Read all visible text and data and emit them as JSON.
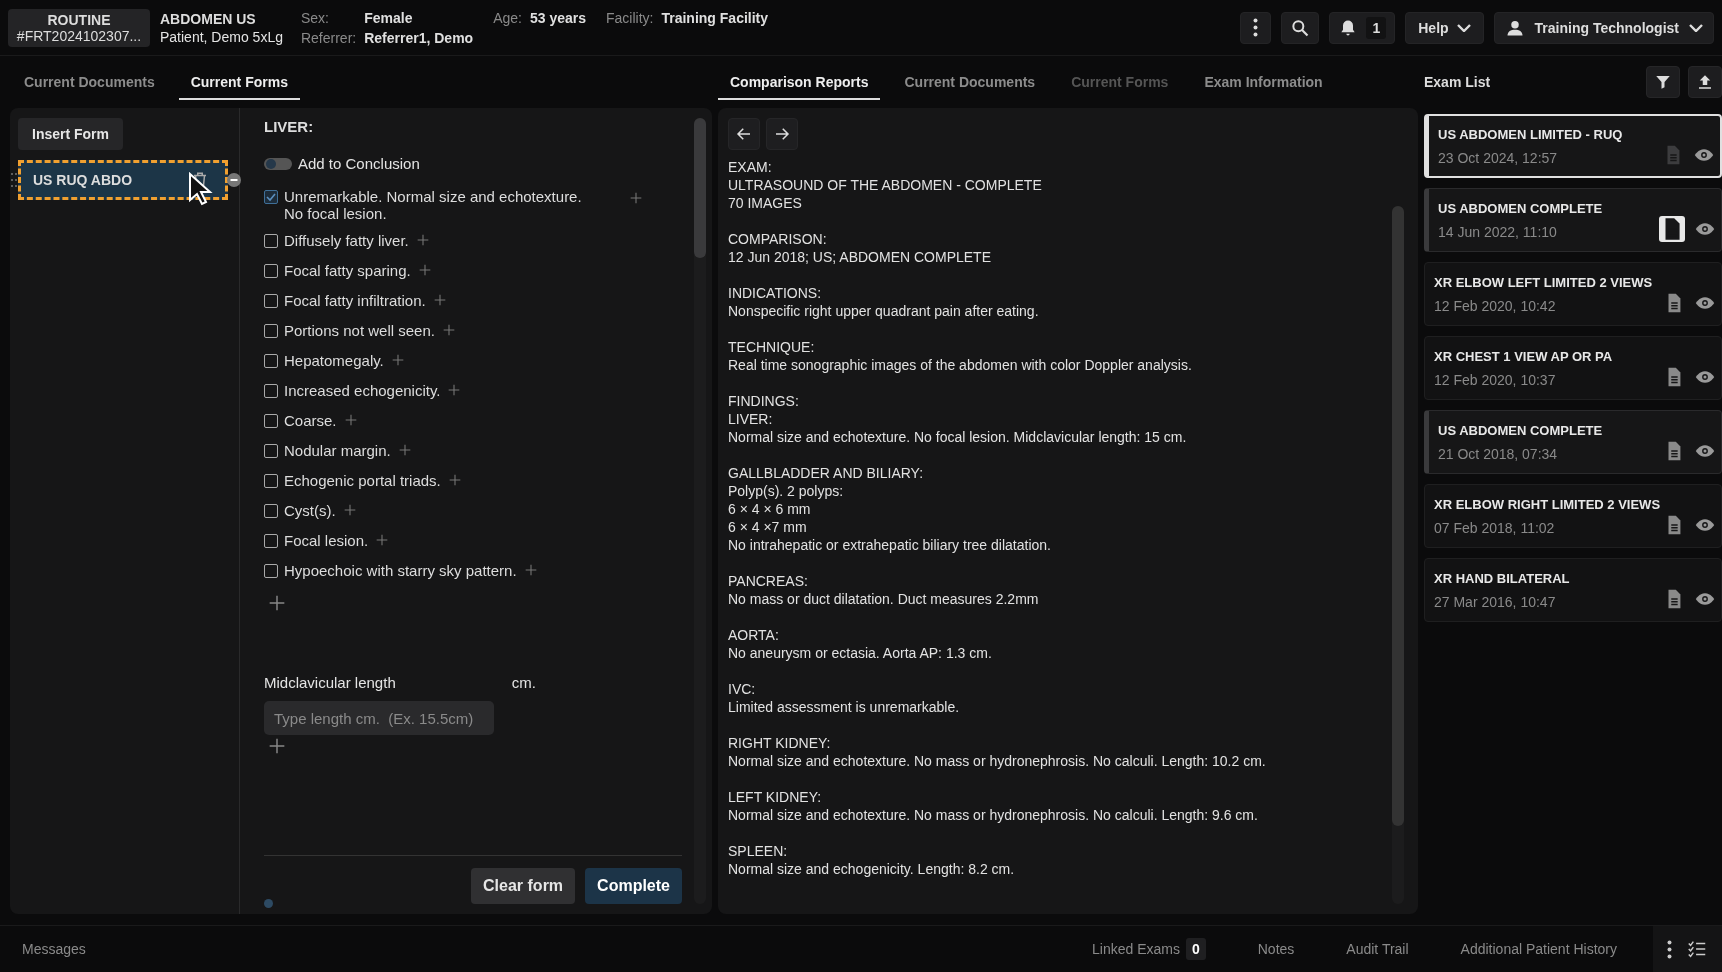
{
  "header": {
    "priority": "ROUTINE",
    "accession": "#FRT2024102307...",
    "exam": "ABDOMEN US",
    "patient": "Patient, Demo 5xLg",
    "fields": [
      {
        "label": "Sex:",
        "value": "Female"
      },
      {
        "label": "Age:",
        "value": "53 years"
      },
      {
        "label": "Facility:",
        "value": "Training Facility"
      },
      {
        "label": "Referrer:",
        "value": "Referrer1, Demo"
      }
    ],
    "notification_count": "1",
    "help": "Help",
    "user": "Training Technologist"
  },
  "left_tabs": [
    {
      "label": "Current Documents",
      "selected": false
    },
    {
      "label": "Current Forms",
      "selected": true
    }
  ],
  "forms_panel": {
    "insert_button": "Insert Form",
    "forms": [
      {
        "name": "US RUQ ABDO",
        "selected": true
      }
    ]
  },
  "form": {
    "section": "LIVER:",
    "conclusion_toggle": {
      "label": "Add to Conclusion",
      "on": false
    },
    "findings": [
      {
        "label": "Unremarkable. Normal size and echotexture. No focal lesion.",
        "checked": true
      },
      {
        "label": "Diffusely fatty liver.",
        "checked": false
      },
      {
        "label": "Focal fatty sparing.",
        "checked": false
      },
      {
        "label": "Focal fatty infiltration.",
        "checked": false
      },
      {
        "label": "Portions not well seen.",
        "checked": false
      },
      {
        "label": "Hepatomegaly.",
        "checked": false
      },
      {
        "label": "Increased echogenicity.",
        "checked": false
      },
      {
        "label": "Coarse.",
        "checked": false
      },
      {
        "label": "Nodular margin.",
        "checked": false
      },
      {
        "label": "Echogenic portal triads.",
        "checked": false
      },
      {
        "label": "Cyst(s).",
        "checked": false
      },
      {
        "label": "Focal lesion.",
        "checked": false
      },
      {
        "label": "Hypoechoic with starry sky pattern.",
        "checked": false
      }
    ],
    "measure": {
      "label": "Midclavicular length",
      "unit": "cm.",
      "placeholder": "Type length cm.  (Ex. 15.5cm)"
    },
    "buttons": [
      {
        "label": "Clear form",
        "kind": "secondary"
      },
      {
        "label": "Complete",
        "kind": "primary"
      }
    ]
  },
  "middle_tabs": [
    {
      "label": "Comparison Reports",
      "selected": true,
      "disabled": false
    },
    {
      "label": "Current Documents",
      "selected": false,
      "disabled": false
    },
    {
      "label": "Current Forms",
      "selected": false,
      "disabled": true
    },
    {
      "label": "Exam Information",
      "selected": false,
      "disabled": false
    }
  ],
  "report": [
    {
      "heading": "EXAM:",
      "lines": [
        "ULTRASOUND OF THE ABDOMEN - COMPLETE",
        "70 IMAGES"
      ]
    },
    {
      "heading": "COMPARISON:",
      "lines": [
        "12 Jun 2018; US; ABDOMEN COMPLETE"
      ]
    },
    {
      "heading": "INDICATIONS:",
      "lines": [
        "Nonspecific right upper quadrant pain after eating."
      ]
    },
    {
      "heading": "TECHNIQUE:",
      "lines": [
        "Real time sonographic images of the abdomen with color Doppler analysis."
      ]
    },
    {
      "heading": "FINDINGS:",
      "lines": [
        "LIVER:",
        "Normal size and echotexture. No focal lesion. Midclavicular length: 15 cm."
      ]
    },
    {
      "heading": "GALLBLADDER AND BILIARY:",
      "lines": [
        "Polyp(s). 2 polyps:",
        "6 × 4 × 6 mm",
        "6 × 4 ×7 mm",
        "No intrahepatic or extrahepatic biliary tree dilatation."
      ]
    },
    {
      "heading": "PANCREAS:",
      "lines": [
        "No mass or duct dilatation. Duct measures 2.2mm"
      ]
    },
    {
      "heading": "AORTA:",
      "lines": [
        "No aneurysm or ectasia. Aorta AP: 1.3 cm."
      ]
    },
    {
      "heading": "IVC:",
      "lines": [
        "Limited assessment is unremarkable."
      ]
    },
    {
      "heading": "RIGHT KIDNEY:",
      "lines": [
        "Normal size and echotexture. No mass or hydronephrosis. No calculi. Length: 10.2 cm."
      ]
    },
    {
      "heading": "LEFT KIDNEY:",
      "lines": [
        "Normal size and echotexture. No mass or hydronephrosis. No calculi. Length: 9.6 cm."
      ]
    },
    {
      "heading": "SPLEEN:",
      "lines": [
        "Normal size and echogenicity. Length: 8.2 cm."
      ]
    }
  ],
  "exam_list": {
    "title": "Exam List",
    "exams": [
      {
        "title": "US ABDOMEN LIMITED - RUQ",
        "date": "23 Oct 2024, 12:57",
        "selected": true,
        "compared": false,
        "report_open": false,
        "report_disabled": true
      },
      {
        "title": "US ABDOMEN COMPLETE",
        "date": "14 Jun 2022, 11:10",
        "selected": false,
        "compared": true,
        "report_open": true,
        "report_disabled": false
      },
      {
        "title": "XR ELBOW LEFT LIMITED 2 VIEWS",
        "date": "12 Feb 2020, 10:42",
        "selected": false,
        "compared": false,
        "report_open": false,
        "report_disabled": false
      },
      {
        "title": "XR CHEST 1 VIEW AP OR PA",
        "date": "12 Feb 2020, 10:37",
        "selected": false,
        "compared": false,
        "report_open": false,
        "report_disabled": false
      },
      {
        "title": "US ABDOMEN COMPLETE",
        "date": "21 Oct 2018, 07:34",
        "selected": false,
        "compared": true,
        "report_open": false,
        "report_disabled": false
      },
      {
        "title": "XR ELBOW RIGHT LIMITED 2 VIEWS",
        "date": "07 Feb 2018, 11:02",
        "selected": false,
        "compared": false,
        "report_open": false,
        "report_disabled": false
      },
      {
        "title": "XR HAND BILATERAL",
        "date": "27 Mar 2016, 10:47",
        "selected": false,
        "compared": false,
        "report_open": false,
        "report_disabled": false
      }
    ]
  },
  "footer": {
    "messages": "Messages",
    "tabs": [
      {
        "label": "Linked Exams",
        "count": "0"
      },
      {
        "label": "Notes"
      },
      {
        "label": "Audit Trail"
      },
      {
        "label": "Additional Patient History"
      }
    ]
  }
}
